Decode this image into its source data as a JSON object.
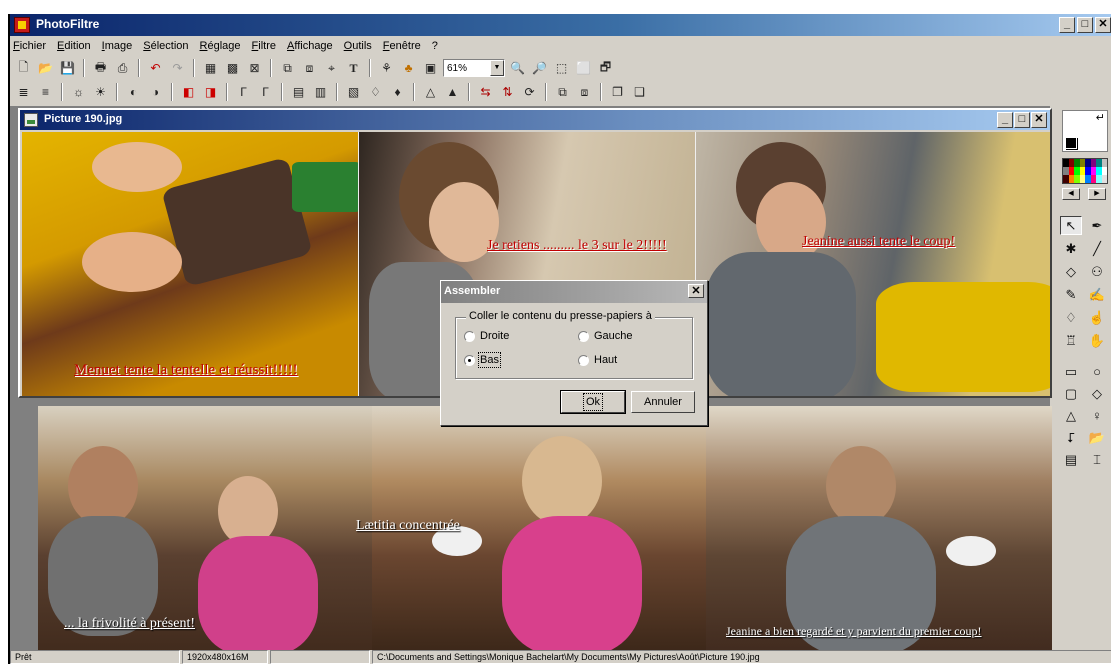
{
  "app": {
    "title": "PhotoFiltre"
  },
  "menu": [
    "Fichier",
    "Edition",
    "Image",
    "Sélection",
    "Réglage",
    "Filtre",
    "Affichage",
    "Outils",
    "Fenêtre",
    "?"
  ],
  "toolbar": {
    "zoom_value": "61%"
  },
  "document": {
    "title": "Picture 190.jpg",
    "captions_top": [
      "Menuet tente la tentelle et réussit!!!!!",
      "Je retiens ......... le 3 sur le 2!!!!!",
      "Jeanine aussi tente le coup!"
    ],
    "captions_bottom": [
      "... la frivolité à présent!",
      "Lætitia concentrée",
      "Jeanine a bien regardé et y parvient du premier coup!"
    ]
  },
  "dialog": {
    "title": "Assembler",
    "group_label": "Coller le contenu du presse-papiers à",
    "options": [
      {
        "label": "Droite",
        "selected": false
      },
      {
        "label": "Gauche",
        "selected": false
      },
      {
        "label": "Bas",
        "selected": true
      },
      {
        "label": "Haut",
        "selected": false
      }
    ],
    "ok_label": "Ok",
    "cancel_label": "Annuler"
  },
  "status": {
    "message": "Prêt",
    "dimensions": "1920x480x16M",
    "path": "C:\\Documents and Settings\\Monique Bachelart\\My Documents\\My Pictures\\Août\\Picture 190.jpg"
  },
  "colors": {
    "title_active": "#0a246a",
    "caption_red": "#c00000",
    "face": "#d4d0c8"
  }
}
